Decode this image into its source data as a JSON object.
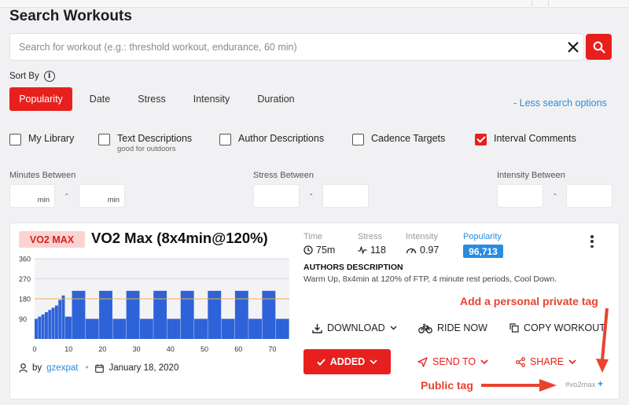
{
  "page": {
    "title": "Search Workouts"
  },
  "search": {
    "placeholder": "Search for workout (e.g.: threshold workout, endurance, 60 min)",
    "value": ""
  },
  "sort": {
    "label": "Sort By",
    "options": [
      "Popularity",
      "Date",
      "Stress",
      "Intensity",
      "Duration"
    ],
    "active": "Popularity"
  },
  "options_link": "- Less search options",
  "filters": {
    "checkboxes": [
      {
        "label": "My Library",
        "sub": "",
        "checked": false
      },
      {
        "label": "Text Descriptions",
        "sub": "good for outdoors",
        "checked": false
      },
      {
        "label": "Author Descriptions",
        "sub": "",
        "checked": false
      },
      {
        "label": "Cadence Targets",
        "sub": "",
        "checked": false
      },
      {
        "label": "Interval Comments",
        "sub": "",
        "checked": true
      }
    ],
    "ranges": [
      {
        "label": "Minutes Between",
        "unit": "min"
      },
      {
        "label": "Stress Between",
        "unit": ""
      },
      {
        "label": "Intensity Between",
        "unit": ""
      }
    ],
    "dash": "-"
  },
  "workout": {
    "tag": "VO2 MAX",
    "title": "VO2 Max (8x4min@120%)",
    "stats": {
      "time_label": "Time",
      "time_value": "75m",
      "stress_label": "Stress",
      "stress_value": "118",
      "intensity_label": "Intensity",
      "intensity_value": "0.97",
      "popularity_label": "Popularity",
      "popularity_value": "96,713"
    },
    "description_heading": "AUTHORS DESCRIPTION",
    "description": "Warm Up, 8x4min at 120% of FTP, 4 minute rest periods, Cool Down.",
    "author_prefix": "by",
    "author": "gzexpat",
    "date": "January 18, 2020",
    "actions": {
      "download": "DOWNLOAD",
      "ride_now": "RIDE NOW",
      "copy": "COPY WORKOUT",
      "added": "ADDED",
      "send_to": "SEND TO",
      "share": "SHARE"
    },
    "hashtag": "#vo2max",
    "add_tag": "+"
  },
  "annotations": {
    "private_tag": "Add a personal private tag",
    "public_tag": "Public tag"
  },
  "colors": {
    "accent_red": "#e8201d",
    "link_blue": "#2a8be0",
    "bar_blue": "#2e62d8",
    "ftp_line": "#f0b24a",
    "annotation": "#e7442f"
  },
  "chart_data": {
    "type": "area",
    "x_ticks": [
      0,
      10,
      20,
      30,
      40,
      50,
      60,
      70
    ],
    "y_ticks": [
      90,
      180,
      270,
      360
    ],
    "xlim": [
      0,
      75
    ],
    "ylim": [
      0,
      360
    ],
    "ftp_reference": 180,
    "segments": [
      {
        "start": 0,
        "end": 1,
        "watts": 90
      },
      {
        "start": 1,
        "end": 2,
        "watts": 100
      },
      {
        "start": 2,
        "end": 3,
        "watts": 110
      },
      {
        "start": 3,
        "end": 4,
        "watts": 120
      },
      {
        "start": 4,
        "end": 5,
        "watts": 130
      },
      {
        "start": 5,
        "end": 6,
        "watts": 140
      },
      {
        "start": 6,
        "end": 7,
        "watts": 150
      },
      {
        "start": 7,
        "end": 8,
        "watts": 175
      },
      {
        "start": 8,
        "end": 9,
        "watts": 195
      },
      {
        "start": 9,
        "end": 11,
        "watts": 100
      },
      {
        "start": 11,
        "end": 15,
        "watts": 216
      },
      {
        "start": 15,
        "end": 19,
        "watts": 90
      },
      {
        "start": 19,
        "end": 23,
        "watts": 216
      },
      {
        "start": 23,
        "end": 27,
        "watts": 90
      },
      {
        "start": 27,
        "end": 31,
        "watts": 216
      },
      {
        "start": 31,
        "end": 35,
        "watts": 90
      },
      {
        "start": 35,
        "end": 39,
        "watts": 216
      },
      {
        "start": 39,
        "end": 43,
        "watts": 90
      },
      {
        "start": 43,
        "end": 47,
        "watts": 216
      },
      {
        "start": 47,
        "end": 51,
        "watts": 90
      },
      {
        "start": 51,
        "end": 55,
        "watts": 216
      },
      {
        "start": 55,
        "end": 59,
        "watts": 90
      },
      {
        "start": 59,
        "end": 63,
        "watts": 216
      },
      {
        "start": 63,
        "end": 67,
        "watts": 90
      },
      {
        "start": 67,
        "end": 71,
        "watts": 216
      },
      {
        "start": 71,
        "end": 75,
        "watts": 90
      }
    ]
  }
}
